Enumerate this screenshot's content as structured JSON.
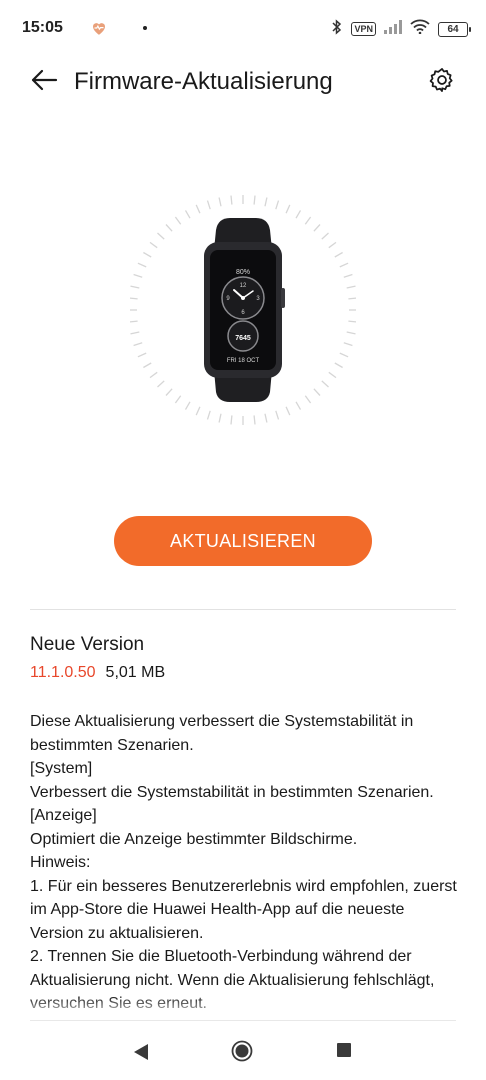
{
  "status_bar": {
    "time": "15:05",
    "vpn": "VPN",
    "battery": "64",
    "icons": [
      "heart-health-icon",
      "bluetooth-icon",
      "signal-icon",
      "wifi-icon"
    ]
  },
  "header": {
    "title": "Firmware-Aktualisierung",
    "back_icon": "arrow-left-icon",
    "settings_icon": "gear-icon"
  },
  "device": {
    "battery_text": "80%",
    "steps": "7645",
    "date_text": "FRI 18 OCT",
    "dial_numbers": [
      "12",
      "3",
      "6",
      "9"
    ]
  },
  "update_button": {
    "label": "AKTUALISIEREN",
    "color": "#f26b2a"
  },
  "release": {
    "section_title": "Neue Version",
    "version": "11.1.0.50",
    "version_color": "#e8472b",
    "size": "5,01 MB",
    "notes": [
      "Diese Aktualisierung verbessert die Systemstabilität in bestimmten Szenarien.",
      "[System]",
      "Verbessert die Systemstabilität in bestimmten Szenarien.",
      "[Anzeige]",
      "Optimiert die Anzeige bestimmter Bildschirme.",
      "Hinweis:",
      "1. Für ein besseres Benutzererlebnis wird empfohlen, zuerst im App-Store die Huawei Health-App auf die neueste Version zu aktualisieren.",
      "2. Trennen Sie die Bluetooth-Verbindung während der Aktualisierung nicht. Wenn die Aktualisierung fehlschlägt, versuchen Sie es erneut."
    ]
  },
  "nav_bar": {
    "icons": [
      "nav-back-icon",
      "nav-home-icon",
      "nav-recent-icon"
    ]
  }
}
